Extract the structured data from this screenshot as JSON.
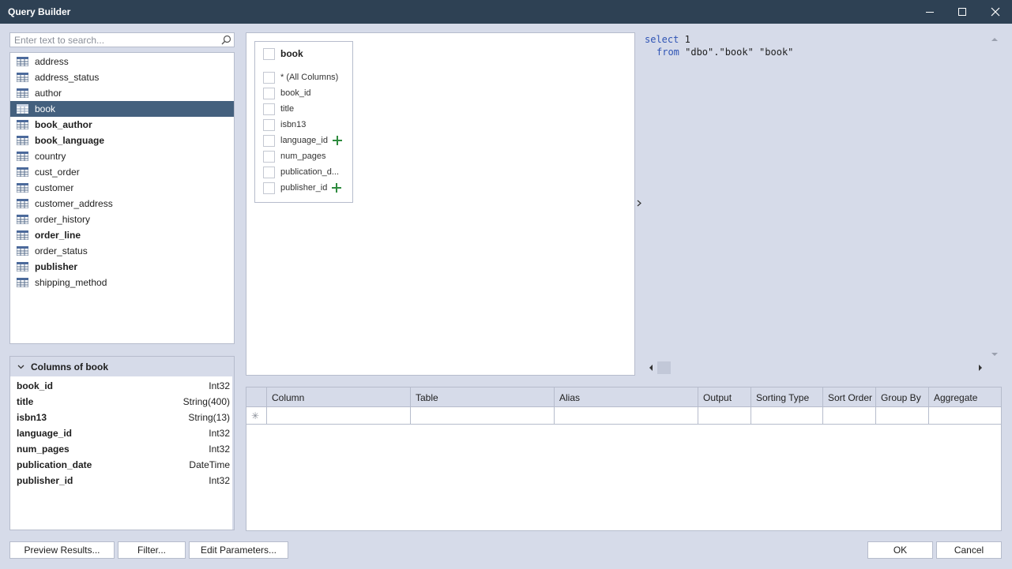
{
  "window": {
    "title": "Query Builder",
    "buttons": [
      "minimize-icon",
      "maximize-icon",
      "close-icon"
    ]
  },
  "search": {
    "placeholder": "Enter text to search...",
    "value": ""
  },
  "tables": [
    {
      "name": "address",
      "bold": false
    },
    {
      "name": "address_status",
      "bold": false
    },
    {
      "name": "author",
      "bold": false
    },
    {
      "name": "book",
      "bold": false,
      "selected": true
    },
    {
      "name": "book_author",
      "bold": true
    },
    {
      "name": "book_language",
      "bold": true
    },
    {
      "name": "country",
      "bold": false
    },
    {
      "name": "cust_order",
      "bold": false
    },
    {
      "name": "customer",
      "bold": false
    },
    {
      "name": "customer_address",
      "bold": false
    },
    {
      "name": "order_history",
      "bold": false
    },
    {
      "name": "order_line",
      "bold": true
    },
    {
      "name": "order_status",
      "bold": false
    },
    {
      "name": "publisher",
      "bold": true
    },
    {
      "name": "shipping_method",
      "bold": false
    }
  ],
  "columns_panel": {
    "title": "Columns of book",
    "columns": [
      {
        "name": "book_id",
        "type": "Int32"
      },
      {
        "name": "title",
        "type": "String(400)"
      },
      {
        "name": "isbn13",
        "type": "String(13)"
      },
      {
        "name": "language_id",
        "type": "Int32"
      },
      {
        "name": "num_pages",
        "type": "Int32"
      },
      {
        "name": "publication_date",
        "type": "DateTime"
      },
      {
        "name": "publisher_id",
        "type": "Int32"
      }
    ]
  },
  "diagram": {
    "table": {
      "name": "book",
      "fields": [
        {
          "name": "* (All Columns)",
          "link": false
        },
        {
          "name": "book_id",
          "link": false
        },
        {
          "name": "title",
          "link": false
        },
        {
          "name": "isbn13",
          "link": false
        },
        {
          "name": "language_id",
          "link": true
        },
        {
          "name": "num_pages",
          "link": false
        },
        {
          "name": "publication_d...",
          "link": false
        },
        {
          "name": "publisher_id",
          "link": true
        }
      ]
    }
  },
  "sql": {
    "line1_kw": "select",
    "line1_rest": " 1",
    "line2_kw": "from",
    "line2_rest": " \"dbo\".\"book\" \"book\""
  },
  "grid": {
    "headers": [
      "Column",
      "Table",
      "Alias",
      "Output",
      "Sorting Type",
      "Sort Order",
      "Group By",
      "Aggregate"
    ],
    "new_row_marker": "✳"
  },
  "buttons": {
    "preview": "Preview Results...",
    "filter": "Filter...",
    "edit_params": "Edit Parameters...",
    "ok": "OK",
    "cancel": "Cancel"
  },
  "colors": {
    "titlebar": "#2e4154",
    "background": "#d6dbe9",
    "selection": "#44607e",
    "keyword": "#2f54b5",
    "link_plus": "#2e8b3e"
  }
}
